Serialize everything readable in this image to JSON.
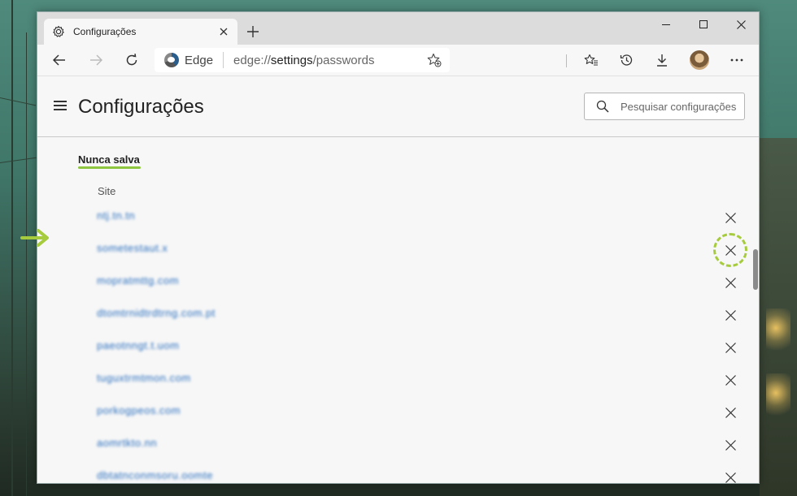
{
  "browser": {
    "tab_title": "Configurações",
    "address_brand": "Edge",
    "url_prefix": "edge://",
    "url_bold": "settings",
    "url_suffix": "/passwords"
  },
  "settings": {
    "title": "Configurações",
    "search_placeholder": "Pesquisar configurações"
  },
  "section": {
    "title": "Nunca salva",
    "column_header": "Site"
  },
  "sites": [
    {
      "site": "ntj.tn.tn"
    },
    {
      "site": "sometestaut.x"
    },
    {
      "site": "mopratmttg.com"
    },
    {
      "site": "dtomtrnidtrdtrng.com.pt"
    },
    {
      "site": "paeotnngt.t.uom"
    },
    {
      "site": "tuguxtrmtmon.com"
    },
    {
      "site": "porkogpeos.com"
    },
    {
      "site": "aomrtkto.nn"
    },
    {
      "site": "dbtatnconmsoru.oomte"
    }
  ],
  "colors": {
    "accent": "#8ec63f",
    "highlight": "#a6cb3c",
    "link": "#2a6fbf"
  },
  "annotations": {
    "highlighted_row": 2
  }
}
